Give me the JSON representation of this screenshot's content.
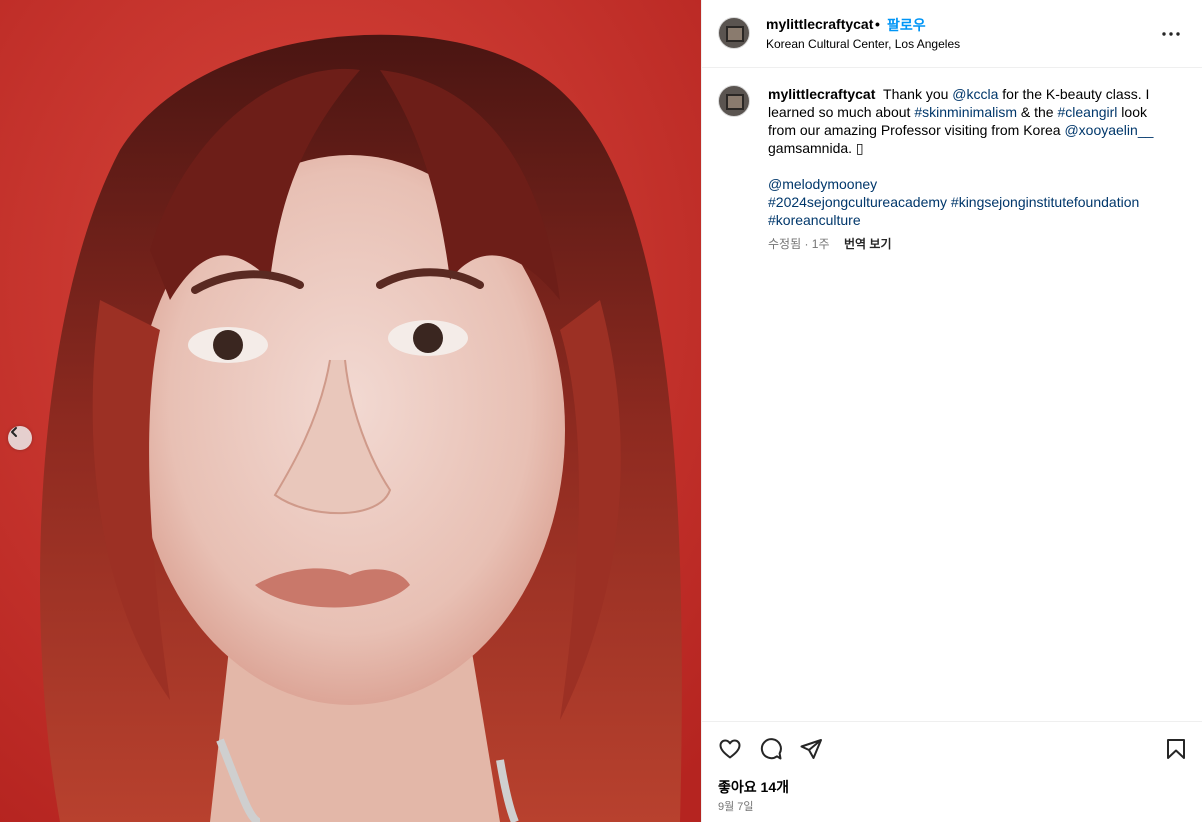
{
  "post": {
    "username": "mylittlecraftycat",
    "separator": "•",
    "follow_label": "팔로우",
    "location": "Korean Cultural Center, Los Angeles"
  },
  "caption": {
    "username": "mylittlecraftycat",
    "t1": " Thank you ",
    "m1": "@kccla",
    "t2": " for the K-beauty class. I learned so much about ",
    "h1": "#skinminimalism",
    "t3": " & the ",
    "h2": "#cleangirl",
    "t4": " look from our amazing Professor visiting from Korea ",
    "m2": "@xooyaelin__",
    "t5": " gamsamnida. ▯",
    "m3": "@melodymooney",
    "h3": "#2024sejongcultureacademy",
    "h4": "#kingsejonginstitutefoundation",
    "h5": "#koreanculture",
    "meta": "수정됨 · 1주",
    "translate_label": "번역 보기"
  },
  "footer": {
    "likes": "좋아요 14개",
    "date": "9월 7일"
  },
  "icons": {
    "prev": "chevron-left-icon",
    "more": "more-horizontal-icon",
    "like": "heart-icon",
    "comment": "comment-icon",
    "share": "send-icon",
    "save": "bookmark-icon"
  },
  "colors": {
    "follow": "#0095f6",
    "link": "#00376b",
    "muted": "#737373",
    "photo_background": "#c3302a"
  }
}
